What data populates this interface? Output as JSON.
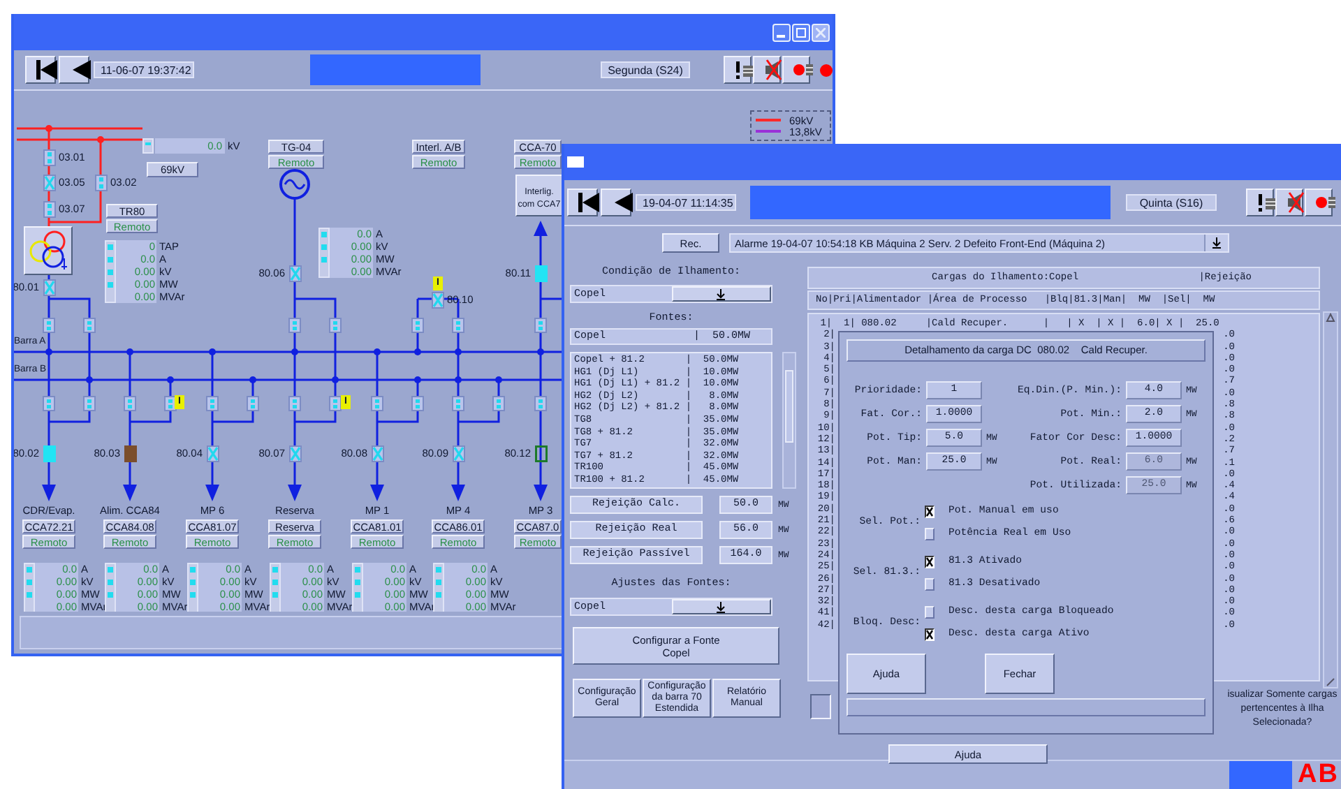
{
  "left_window": {
    "date": "11-06-07 19:37:42",
    "day": "Segunda (S24)",
    "legend": [
      {
        "label": "69kV",
        "color": "#ff2a2a"
      },
      {
        "label": "13,8kV",
        "color": "#9a30d8"
      }
    ],
    "voltage": {
      "value": "0.0",
      "unit": "kV",
      "base": "69kV"
    },
    "breakers": [
      {
        "label": "03.01",
        "kind": "closed"
      },
      {
        "label": "03.05",
        "kind": "crossed"
      },
      {
        "label": "03.07",
        "kind": "closed"
      },
      {
        "label": "03.02",
        "kind": "closed"
      },
      {
        "label": "80.01",
        "kind": "crossed"
      },
      {
        "label": "80.06",
        "kind": "crossed"
      },
      {
        "label": "80.10",
        "kind": "crossed"
      },
      {
        "label": "80.11",
        "kind": "filled"
      },
      {
        "label": "80.02",
        "kind": "filled"
      },
      {
        "label": "80.03",
        "kind": "fault"
      },
      {
        "label": "80.04",
        "kind": "crossed"
      },
      {
        "label": "80.07",
        "kind": "crossed"
      },
      {
        "label": "80.08",
        "kind": "crossed"
      },
      {
        "label": "80.09",
        "kind": "crossed"
      },
      {
        "label": "80.12",
        "kind": "open"
      }
    ],
    "flags": [
      "I",
      "I",
      "I"
    ],
    "tags": [
      {
        "name": "TR80",
        "status": "Remoto"
      },
      {
        "name": "TG-04",
        "status": "Remoto"
      },
      {
        "name": "Interl. A/B",
        "status": "Remoto"
      },
      {
        "name": "CCA-70",
        "status": "Remoto"
      }
    ],
    "interlink_button": "Interlig.\ncom CCA7",
    "meters": [
      {
        "rows": [
          {
            "value": "0",
            "unit": "TAP"
          },
          {
            "value": "0.0",
            "unit": "A"
          },
          {
            "value": "0.00",
            "unit": "kV"
          },
          {
            "value": "0.00",
            "unit": "MW"
          },
          {
            "value": "0.00",
            "unit": "MVAr"
          }
        ]
      },
      {
        "rows": [
          {
            "value": "0.0",
            "unit": "A"
          },
          {
            "value": "0.00",
            "unit": "kV"
          },
          {
            "value": "0.00",
            "unit": "MW"
          },
          {
            "value": "0.00",
            "unit": "MVAr"
          }
        ]
      }
    ],
    "buses": [
      "Barra A",
      "Barra B"
    ],
    "feeders": [
      {
        "title": "CDR/Evap.",
        "tag": "CCA72.21",
        "status": "Remoto",
        "rows": [
          {
            "value": "0.0",
            "unit": "A"
          },
          {
            "value": "0.00",
            "unit": "kV"
          },
          {
            "value": "0.00",
            "unit": "MW"
          },
          {
            "value": "0.00",
            "unit": "MVAr"
          }
        ]
      },
      {
        "title": "Alim. CCA84",
        "tag": "CCA84.08",
        "status": "Remoto",
        "rows": [
          {
            "value": "0.0",
            "unit": "A"
          },
          {
            "value": "0.00",
            "unit": "kV"
          },
          {
            "value": "0.00",
            "unit": "MW"
          },
          {
            "value": "0.00",
            "unit": "MVAr"
          }
        ]
      },
      {
        "title": "MP 6",
        "tag": "CCA81.07",
        "status": "Remoto",
        "rows": [
          {
            "value": "0.0",
            "unit": "A"
          },
          {
            "value": "0.00",
            "unit": "kV"
          },
          {
            "value": "0.00",
            "unit": "MW"
          },
          {
            "value": "0.00",
            "unit": "MVAr"
          }
        ]
      },
      {
        "title": "Reserva",
        "tag": "Reserva",
        "status": "Remoto",
        "rows": [
          {
            "value": "0.0",
            "unit": "A"
          },
          {
            "value": "0.00",
            "unit": "kV"
          },
          {
            "value": "0.00",
            "unit": "MW"
          },
          {
            "value": "0.00",
            "unit": "MVAr"
          }
        ]
      },
      {
        "title": "MP 1",
        "tag": "CCA81.01",
        "status": "Remoto",
        "rows": [
          {
            "value": "0.0",
            "unit": "A"
          },
          {
            "value": "0.00",
            "unit": "kV"
          },
          {
            "value": "0.00",
            "unit": "MW"
          },
          {
            "value": "0.00",
            "unit": "MVAr"
          }
        ]
      },
      {
        "title": "MP 4",
        "tag": "CCA86.01",
        "status": "Remoto",
        "rows": [
          {
            "value": "0.0",
            "unit": "A"
          },
          {
            "value": "0.00",
            "unit": "kV"
          },
          {
            "value": "0.00",
            "unit": "MW"
          },
          {
            "value": "0.00",
            "unit": "MVAr"
          }
        ]
      },
      {
        "title": "MP 3",
        "tag": "CCA87.0",
        "status": "Remoto"
      }
    ]
  },
  "right_window": {
    "date": "19-04-07 11:14:35",
    "day": "Quinta (S16)",
    "rec_button": "Rec.",
    "alarm": "Alarme 19-04-07 10:54:18 KB Máquina 2 Serv. 2 Defeito Front-End (Máquina 2)",
    "island_label": "Condição de Ilhamento:",
    "island_value": "Copel",
    "sources_label": "Fontes:",
    "source_selected": "Copel              |  50.0MW",
    "sources": [
      "Copel + 81.2       |  50.0MW",
      "HG1 (Dj L1)        |  10.0MW",
      "HG1 (Dj L1) + 81.2 |  10.0MW",
      "HG2 (Dj L2)        |   8.0MW",
      "HG2 (Dj L2) + 81.2 |   8.0MW",
      "TG8                |  35.0MW",
      "TG8 + 81.2         |  35.0MW",
      "TG7                |  32.0MW",
      "TG7 + 81.2         |  32.0MW",
      "TR100              |  45.0MW",
      "TR100 + 81.2       |  45.0MW"
    ],
    "rejections": [
      {
        "label": "Rejeição Calc.",
        "value": "50.0",
        "unit": "MW"
      },
      {
        "label": "Rejeição Real",
        "value": "56.0",
        "unit": "MW"
      },
      {
        "label": "Rejeição Passível",
        "value": "164.0",
        "unit": "MW"
      }
    ],
    "adjust_label": "Ajustes das Fontes:",
    "adjust_value": "Copel",
    "configure_button": "Configurar a Fonte\nCopel",
    "bottom_buttons": [
      "Configuração\nGeral",
      "Configuração\nda barra 70\nEstendida",
      "Relatório\nManual"
    ],
    "table": {
      "title": "Cargas do Ilhamento:Copel",
      "title_right": "|Rejeição",
      "header": "No|Pri|Alimentador |Área de Processo   |Blq|81.3|Man|  MW  |Sel|  MW",
      "first_row": " 1|  1| 080.02     |Cald Recuper.      |   | X  | X |  6.0| X |  25.0",
      "rows": [
        {
          "no": "2|",
          "tail": ".0"
        },
        {
          "no": "3|",
          "tail": ".0"
        },
        {
          "no": "4|",
          "tail": ".0"
        },
        {
          "no": "5|",
          "tail": ".0"
        },
        {
          "no": "6|",
          "tail": ".7"
        },
        {
          "no": "7|",
          "tail": ".0"
        },
        {
          "no": "8|",
          "tail": ".8"
        },
        {
          "no": "9|",
          "tail": ".8"
        },
        {
          "no": "10|",
          "tail": ".0"
        },
        {
          "no": "12|",
          "tail": ".2"
        },
        {
          "no": "13|",
          "tail": ".7"
        },
        {
          "no": "14|",
          "tail": ".1"
        },
        {
          "no": "17|",
          "tail": ".0"
        },
        {
          "no": "18|",
          "tail": ".4"
        },
        {
          "no": "19|",
          "tail": ".4"
        },
        {
          "no": "20|",
          "tail": ".0"
        },
        {
          "no": "21|",
          "tail": ".6"
        },
        {
          "no": "22|",
          "tail": ".0"
        },
        {
          "no": "23|",
          "tail": ".0"
        },
        {
          "no": "24|",
          "tail": ".0"
        },
        {
          "no": "25|",
          "tail": ".0"
        },
        {
          "no": "26|",
          "tail": ".0"
        },
        {
          "no": "27|",
          "tail": ".0"
        },
        {
          "no": "32|",
          "tail": ".0"
        },
        {
          "no": "41|",
          "tail": ".0"
        },
        {
          "no": "42|",
          "tail": ".0"
        }
      ]
    },
    "filter_checked": false,
    "filter_text": "isualizar Somente cargas pertencentes à Ilha Selecionada?",
    "help_button": "Ajuda",
    "logo": "AB"
  },
  "dialog": {
    "title": "Detalhamento da carga DC  080.02    Cald Recuper.",
    "left_fields": [
      {
        "label": "Prioridade:",
        "value": "1",
        "disabled": false
      },
      {
        "label": "Fat. Cor.:",
        "value": "1.0000",
        "disabled": false
      },
      {
        "label": "Pot. Tip:",
        "value": "5.0",
        "unit": "MW",
        "disabled": false
      },
      {
        "label": "Pot. Man:",
        "value": "25.0",
        "unit": "MW",
        "disabled": false
      }
    ],
    "right_fields": [
      {
        "label": "Eq.Din.(P. Min.):",
        "value": "4.0",
        "unit": "MW",
        "disabled": false
      },
      {
        "label": "Pot. Min.:",
        "value": "2.0",
        "unit": "MW",
        "disabled": false
      },
      {
        "label": "Fator Cor Desc:",
        "value": "1.0000",
        "disabled": false
      },
      {
        "label": "Pot. Real:",
        "value": "6.0",
        "unit": "MW",
        "disabled": true
      },
      {
        "label": "Pot. Utilizada:",
        "value": "25.0",
        "unit": "MW",
        "disabled": true
      }
    ],
    "groups": [
      {
        "label": "Sel. Pot.:",
        "options": [
          {
            "label": "Pot. Manual em uso",
            "checked": true
          },
          {
            "label": "Potência Real em Uso",
            "checked": false
          }
        ]
      },
      {
        "label": "Sel. 81.3.:",
        "options": [
          {
            "label": "81.3 Ativado",
            "checked": true
          },
          {
            "label": "81.3 Desativado",
            "checked": false
          }
        ]
      },
      {
        "label": "Bloq. Desc:",
        "options": [
          {
            "label": "Desc. desta carga Bloqueado",
            "checked": false
          },
          {
            "label": "Desc. desta carga Ativo",
            "checked": true
          }
        ]
      }
    ],
    "buttons": [
      "Ajuda",
      "Fechar"
    ]
  }
}
